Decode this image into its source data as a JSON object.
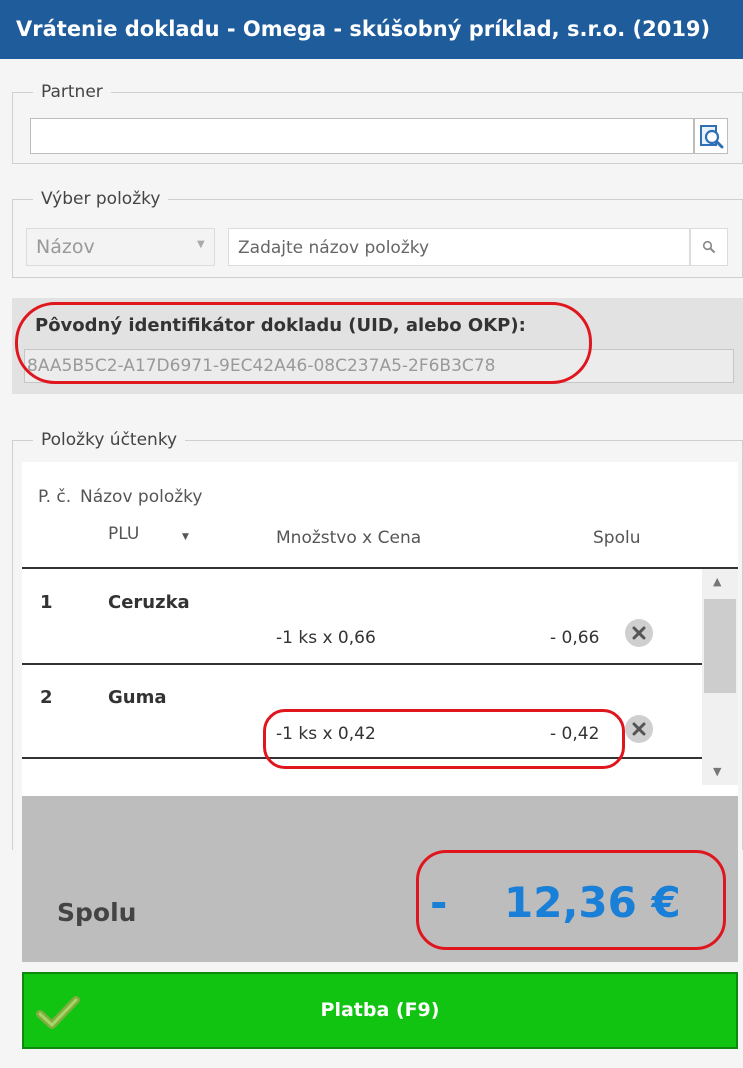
{
  "window": {
    "title": "Vrátenie dokladu - Omega - skúšobný príklad, s.r.o. (2019)"
  },
  "partner": {
    "legend": "Partner",
    "value": ""
  },
  "item_selection": {
    "legend": "Výber položky",
    "mode": "Názov",
    "placeholder": "Zadajte názov položky"
  },
  "original_doc": {
    "label": "Pôvodný identifikátor dokladu (UID, alebo OKP):",
    "value": "8AA5B5C2-A17D6971-9EC42A46-08C237A5-2F6B3C78"
  },
  "receipt": {
    "legend": "Položky účtenky",
    "headers": {
      "num": "P. č.",
      "name": "Názov položky",
      "plu": "PLU",
      "qty_price": "Množstvo x Cena",
      "total": "Spolu"
    },
    "items": [
      {
        "num": "1",
        "name": "Ceruzka",
        "qty_price": "-1 ks x 0,66",
        "total": "- 0,66"
      },
      {
        "num": "2",
        "name": "Guma",
        "qty_price": "-1 ks x 0,42",
        "total": "- 0,42"
      }
    ]
  },
  "summary": {
    "label": "Spolu",
    "sign": "-",
    "amount": "12,36 €"
  },
  "pay_button": {
    "label": "Platba (F9)"
  },
  "colors": {
    "title_bar": "#1f5c9c",
    "total_amount": "#1a7fd6",
    "pay_button": "#11c411",
    "annotation": "#e0161f"
  }
}
